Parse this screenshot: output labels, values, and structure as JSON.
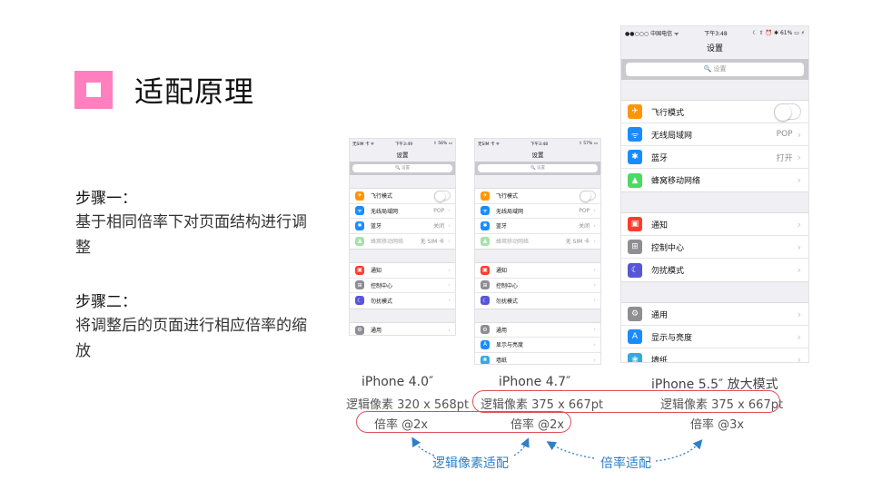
{
  "slide": {
    "title": "适配原理",
    "step1": {
      "heading": "步骤一：",
      "body": "基于相同倍率下对页面结构进行调整"
    },
    "step2": {
      "heading": "步骤二：",
      "body": "将调整后的页面进行相应倍率的缩放"
    }
  },
  "phones": {
    "small": {
      "status": {
        "left": "无SIM 卡 ᯤ",
        "time": "下午3:49",
        "right": "⇧ 56% ▭"
      },
      "status2": {
        "left": "无SIM 卡 ᯤ",
        "time": "下午3:48",
        "right": "⇧ 57% ▭"
      },
      "title": "设置",
      "search_placeholder": "🔍 设置",
      "items": {
        "airplane": "飞行模式",
        "wifi": "无线局域网",
        "wifi_value": "POP",
        "bluetooth": "蓝牙",
        "bluetooth_value": "关闭",
        "cellular": "蜂窝移动网络",
        "cellular_value": "无 SIM 卡",
        "notifications": "通知",
        "control_center": "控制中心",
        "dnd": "勿扰模式",
        "general": "通用",
        "display": "显示与亮度",
        "wallpaper": "墙纸"
      }
    },
    "big": {
      "status": {
        "left": "●●○○○ 中国电信 ᯤ",
        "time": "下午3:48",
        "right": "☾ ⇧ ⏰ ✱ 61% ▭ ⚡"
      },
      "title": "设置",
      "search_placeholder": "🔍 设置",
      "items": {
        "airplane": "飞行模式",
        "wifi": "无线局域网",
        "wifi_value": "POP",
        "bluetooth": "蓝牙",
        "bluetooth_value": "打开",
        "cellular": "蜂窝移动网络",
        "notifications": "通知",
        "control_center": "控制中心",
        "dnd": "勿扰模式",
        "general": "通用",
        "display": "显示与亮度",
        "wallpaper": "墙纸"
      }
    }
  },
  "captions": {
    "iphone4": "iPhone 4.0″",
    "iphone47": "iPhone 4.7″",
    "iphone55": "iPhone 5.5″ 放大模式",
    "px4": "逻辑像素 320 x 568pt",
    "px47": "逻辑像素 375 x 667pt",
    "px55": "逻辑像素 375 x 667pt",
    "scale4": "倍率 @2x",
    "scale47": "倍率 @2x",
    "scale55": "倍率 @3x",
    "label_logical": "逻辑像素适配",
    "label_scale": "倍率适配"
  },
  "colors": {
    "accent": "#ff7fbf",
    "oval": "#e0505a",
    "label_blue": "#2f7fc8"
  },
  "icons": [
    "airplane-icon",
    "wifi-icon",
    "bluetooth-icon",
    "cellular-icon",
    "notifications-icon",
    "control-center-icon",
    "moon-icon",
    "gear-icon",
    "display-icon",
    "wallpaper-icon",
    "chevron-right-icon",
    "search-icon"
  ]
}
